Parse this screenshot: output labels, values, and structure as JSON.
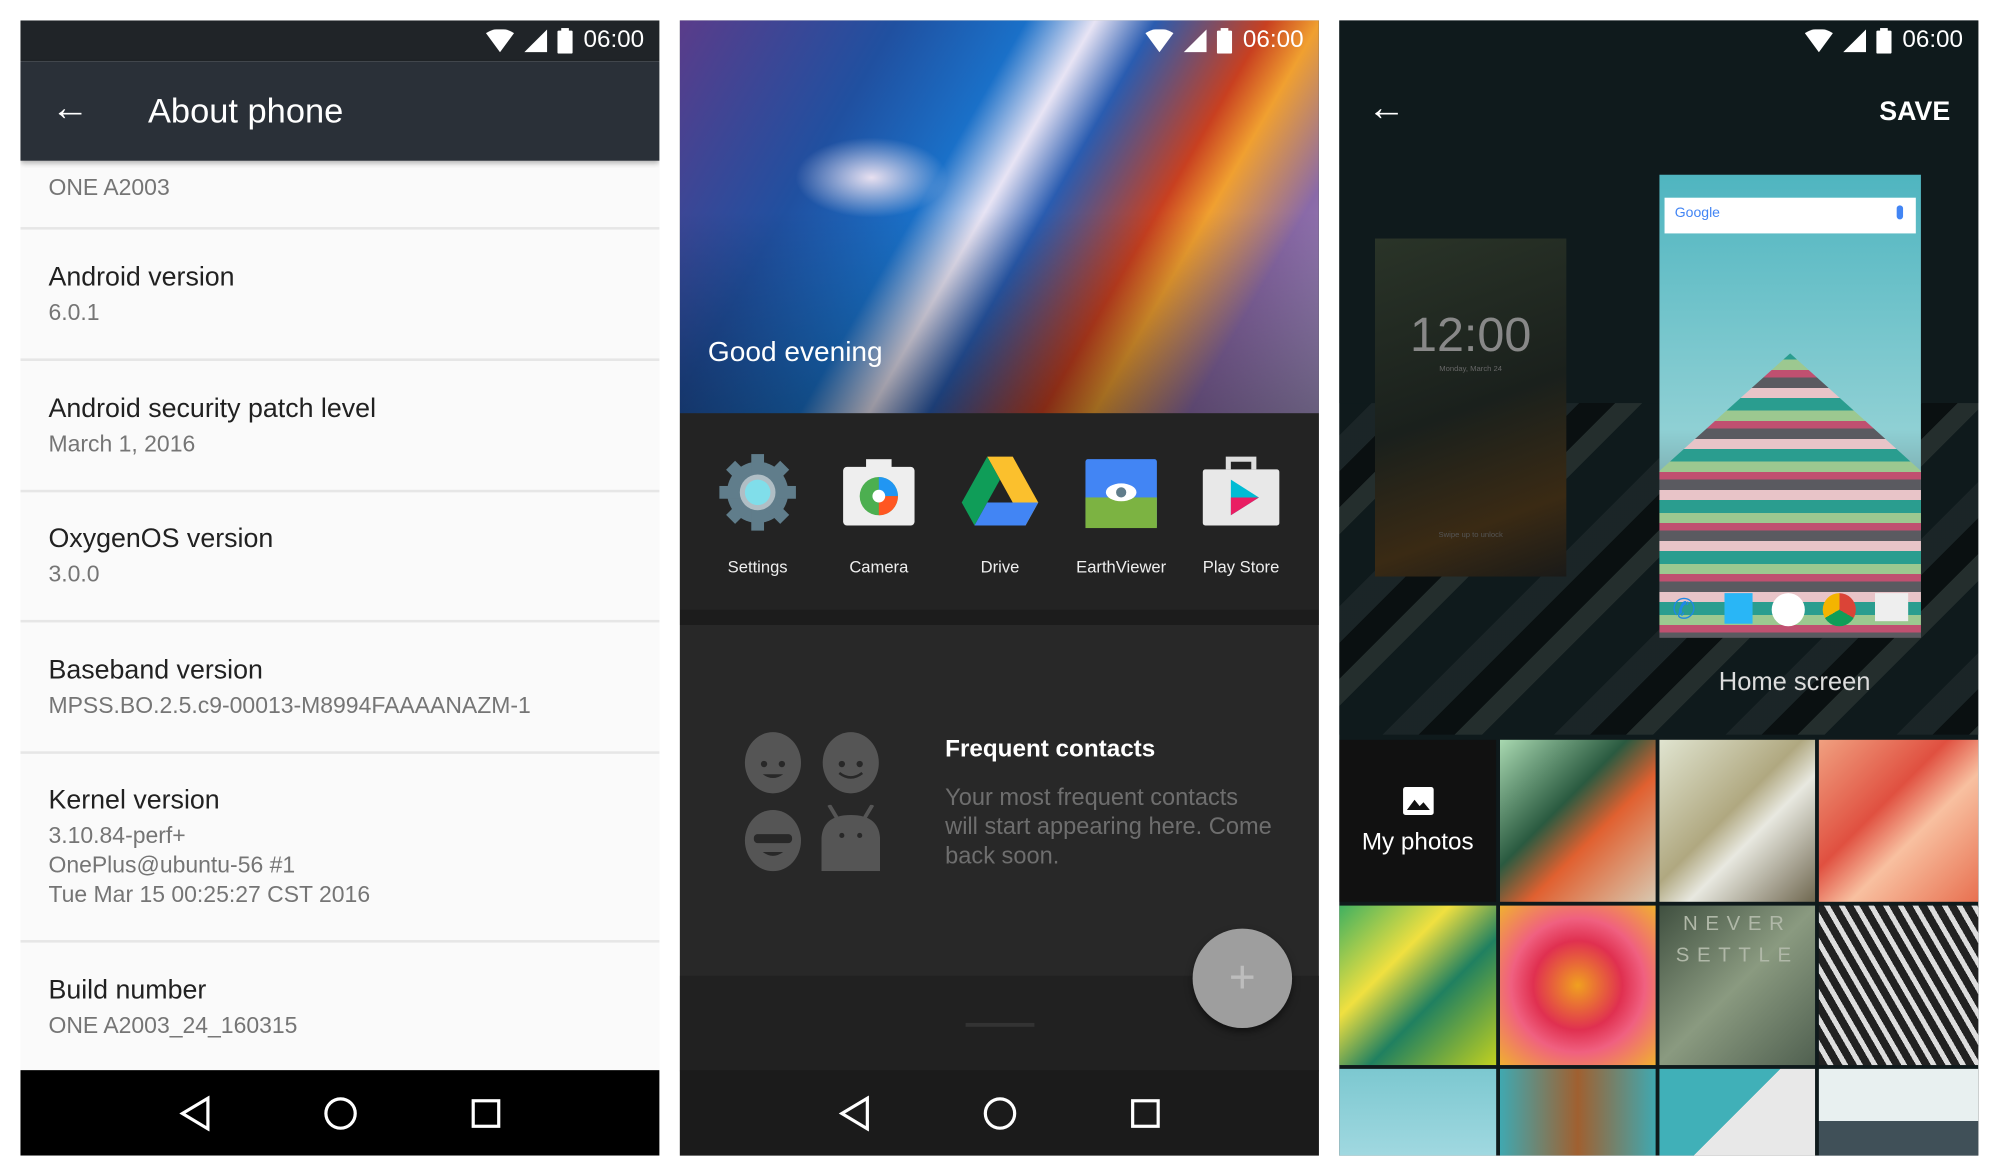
{
  "status_bar": {
    "time": "06:00"
  },
  "about_phone": {
    "title": "About phone",
    "model": "ONE A2003",
    "items": [
      {
        "title": "Android version",
        "values": [
          "6.0.1"
        ]
      },
      {
        "title": "Android security patch level",
        "values": [
          "March 1, 2016"
        ]
      },
      {
        "title": "OxygenOS version",
        "values": [
          "3.0.0"
        ]
      },
      {
        "title": "Baseband version",
        "values": [
          "MPSS.BO.2.5.c9-00013-M8994FAAAANAZM-1"
        ]
      },
      {
        "title": "Kernel version",
        "values": [
          "3.10.84-perf+",
          "OnePlus@ubuntu-56 #1",
          "Tue Mar 15 00:25:27 CST 2016"
        ]
      },
      {
        "title": "Build number",
        "values": [
          "ONE A2003_24_160315"
        ]
      }
    ]
  },
  "shelf": {
    "greeting": "Good evening",
    "apps": [
      {
        "label": "Settings",
        "icon": "settings-gear-icon"
      },
      {
        "label": "Camera",
        "icon": "camera-icon"
      },
      {
        "label": "Drive",
        "icon": "drive-icon"
      },
      {
        "label": "EarthViewer",
        "icon": "earthviewer-icon"
      },
      {
        "label": "Play Store",
        "icon": "play-store-icon"
      }
    ],
    "contacts": {
      "title": "Frequent contacts",
      "message": "Your most frequent contacts will start appearing here. Come back soon."
    },
    "fab": "+"
  },
  "wallpaper": {
    "save": "SAVE",
    "lock_preview": {
      "time": "12:00",
      "date": "Monday, March 24",
      "hint": "Swipe up to unlock"
    },
    "home_preview": {
      "search": "Google"
    },
    "preview_label": "Home screen",
    "my_photos": "My photos",
    "overlay_text": [
      "NEVER",
      "SETTLE"
    ]
  }
}
